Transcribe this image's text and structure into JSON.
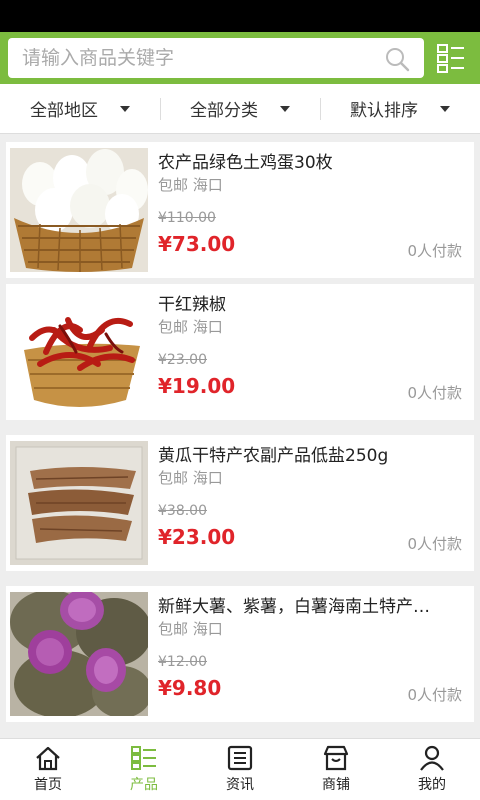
{
  "search": {
    "placeholder": "请输入商品关键字"
  },
  "filters": [
    {
      "label": "全部地区"
    },
    {
      "label": "全部分类"
    },
    {
      "label": "默认排序"
    }
  ],
  "products": [
    {
      "title": "农产品绿色土鸡蛋30枚",
      "ship": "包邮 海口",
      "old_price": "¥110.00",
      "price": "¥73.00",
      "paid": "0人付款"
    },
    {
      "title": "干红辣椒",
      "ship": "包邮 海口",
      "old_price": "¥23.00",
      "price": "¥19.00",
      "paid": "0人付款"
    },
    {
      "title": "黄瓜干特产农副产品低盐250g",
      "ship": "包邮 海口",
      "old_price": "¥38.00",
      "price": "¥23.00",
      "paid": "0人付款"
    },
    {
      "title": "新鲜大薯、紫薯，白薯海南土特产…",
      "ship": "包邮 海口",
      "old_price": "¥12.00",
      "price": "¥9.80",
      "paid": "0人付款"
    }
  ],
  "tabs": [
    {
      "label": "首页",
      "icon": "home-icon"
    },
    {
      "label": "产品",
      "icon": "list-icon",
      "active": true
    },
    {
      "label": "资讯",
      "icon": "news-icon"
    },
    {
      "label": "商铺",
      "icon": "store-icon"
    },
    {
      "label": "我的",
      "icon": "user-icon"
    }
  ],
  "colors": {
    "brand": "#7cbc3f",
    "price": "#e0242a"
  }
}
